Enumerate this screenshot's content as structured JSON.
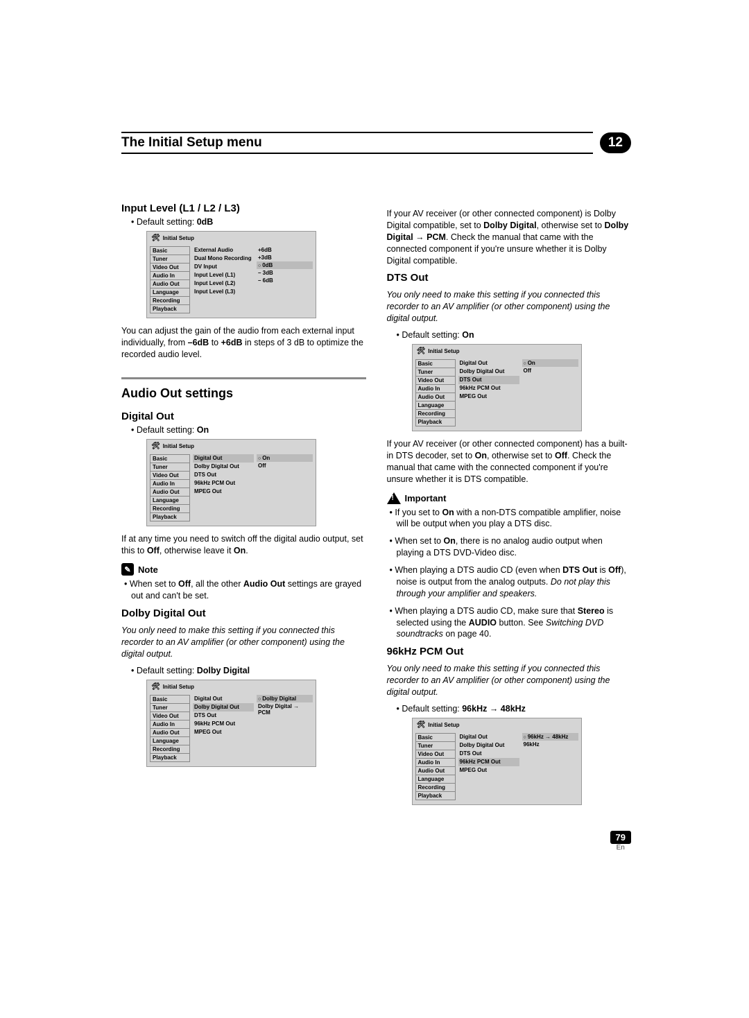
{
  "header": {
    "title": "The Initial Setup menu",
    "chapter": "12"
  },
  "page": {
    "number": "79",
    "lang": "En"
  },
  "panel_labels": {
    "title": "Initial Setup",
    "left": [
      "Basic",
      "Tuner",
      "Video Out",
      "Audio In",
      "Audio Out",
      "Language",
      "Recording",
      "Playback"
    ]
  },
  "left": {
    "input_level": {
      "heading": "Input Level (L1 / L2 / L3)",
      "default_prefix": "Default setting: ",
      "default_value": "0dB",
      "panel_mid": [
        "External Audio",
        "Dual Mono Recording",
        "DV Input",
        "Input Level (L1)",
        "Input Level (L2)",
        "Input Level (L3)"
      ],
      "panel_right": [
        "+6dB",
        "+3dB",
        "0dB",
        "– 3dB",
        "– 6dB"
      ],
      "body_a": "You can adjust the gain of the audio from each external input individually, from ",
      "body_b": "–6dB",
      "body_c": " to ",
      "body_d": "+6dB",
      "body_e": " in steps of 3 dB to optimize the recorded audio level."
    },
    "audio_out_section": "Audio Out settings",
    "digital_out": {
      "heading": "Digital Out",
      "default_prefix": "Default setting: ",
      "default_value": "On",
      "panel_mid": [
        "Digital Out",
        "Dolby Digital Out",
        "DTS Out",
        "96kHz PCM Out",
        "MPEG Out"
      ],
      "panel_right": [
        "On",
        "Off"
      ],
      "body_a": "If at any time you need to switch off the digital audio output, set this to ",
      "body_b": "Off",
      "body_c": ", otherwise leave it ",
      "body_d": "On",
      "body_e": "."
    },
    "note_label": "Note",
    "note_a": "When set to ",
    "note_b": "Off",
    "note_c": ", all the other ",
    "note_d": "Audio Out",
    "note_e": " settings are grayed out and can't be set.",
    "dolby": {
      "heading": "Dolby Digital Out",
      "condition": "You only need to make this setting if you connected this recorder to an AV amplifier (or other component) using the digital output.",
      "default_prefix": "Default setting: ",
      "default_value": "Dolby Digital",
      "panel_mid": [
        "Digital Out",
        "Dolby Digital Out",
        "DTS Out",
        "96kHz PCM Out",
        "MPEG Out"
      ],
      "panel_right": [
        "Dolby Digital",
        "Dolby Digital → PCM"
      ]
    }
  },
  "right": {
    "dolby_cont_a": "If your AV receiver (or other connected component) is Dolby Digital compatible, set to ",
    "dolby_cont_b": "Dolby Digital",
    "dolby_cont_c": ", otherwise set to ",
    "dolby_cont_d": "Dolby Digital → PCM",
    "dolby_cont_e": ". Check the manual that came with the connected component if you're unsure whether it is Dolby Digital compatible.",
    "dts": {
      "heading": "DTS Out",
      "condition": "You only need to make this setting if you connected this recorder to an AV amplifier (or other component) using the digital output.",
      "default_prefix": "Default setting: ",
      "default_value": "On",
      "panel_mid": [
        "Digital Out",
        "Dolby Digital Out",
        "DTS Out",
        "96kHz PCM Out",
        "MPEG Out"
      ],
      "panel_right": [
        "On",
        "Off"
      ],
      "body_a": "If your AV receiver (or other connected component) has a built-in DTS decoder, set to ",
      "body_b": "On",
      "body_c": ", otherwise set to ",
      "body_d": "Off",
      "body_e": ". Check the manual that came with the connected component if you're unsure whether it is DTS compatible."
    },
    "important_label": "Important",
    "imp1_a": "If you set to ",
    "imp1_b": "On",
    "imp1_c": " with a non-DTS compatible amplifier, noise will be output when you play a DTS disc.",
    "imp2_a": "When set to ",
    "imp2_b": "On",
    "imp2_c": ", there is no analog audio output when playing a DTS DVD-Video disc.",
    "imp3_a": "When playing a DTS audio CD (even when ",
    "imp3_b": "DTS Out",
    "imp3_c": " is ",
    "imp3_d": "Off",
    "imp3_e": "), noise is output from the analog outputs. ",
    "imp3_f": "Do not play this through your amplifier and speakers.",
    "imp4_a": "When playing a DTS audio CD, make sure that ",
    "imp4_b": "Stereo",
    "imp4_c": " is selected using the ",
    "imp4_d": "AUDIO",
    "imp4_e": " button. See ",
    "imp4_f": "Switching DVD soundtracks",
    "imp4_g": " on page 40.",
    "pcm": {
      "heading": "96kHz PCM Out",
      "condition": "You only need to make this setting if you connected this recorder to an AV amplifier (or other component) using the digital output.",
      "default_prefix": "Default setting: ",
      "default_value": "96kHz → 48kHz",
      "panel_mid": [
        "Digital Out",
        "Dolby Digital Out",
        "DTS Out",
        "96kHz PCM Out",
        "MPEG Out"
      ],
      "panel_right": [
        "96kHz → 48kHz",
        "96kHz"
      ]
    }
  }
}
